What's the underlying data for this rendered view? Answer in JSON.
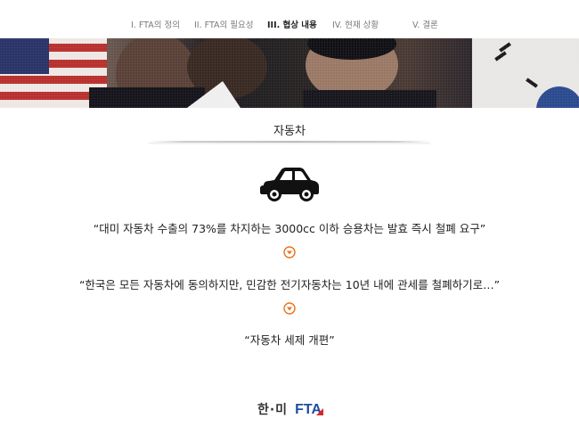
{
  "nav": {
    "items": [
      {
        "label": "I. FTA의 정의",
        "active": false
      },
      {
        "label": "II. FTA의 필요성",
        "active": false
      },
      {
        "label": "III. 협상 내용",
        "active": true
      },
      {
        "label": "IV. 현재 상황",
        "active": false
      },
      {
        "label": "V. 결론",
        "active": false
      }
    ]
  },
  "section": {
    "title": "자동차",
    "icon": "car-icon"
  },
  "quotes": [
    "“대미 자동차 수출의 73%를 차지하는 3000cc 이하 승용차는 발효 즉시 철폐 요구”",
    "“한국은 모든 자동차에 동의하지만, 민감한 전기자동차는 10년 내에 관세를 철폐하기로…”",
    "“자동차 세제 개편”"
  ],
  "arrows": [
    "chevron-down-circle-icon",
    "chevron-down-circle-icon"
  ],
  "colors": {
    "accent_orange": "#e8731f",
    "logo_blue": "#1f4e9c",
    "logo_red": "#d7262b"
  },
  "logo": {
    "korean": "한·미",
    "fta": "FTA"
  }
}
